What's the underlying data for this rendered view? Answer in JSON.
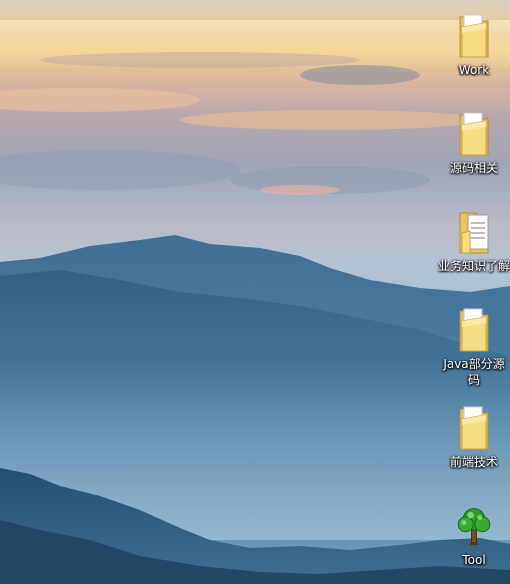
{
  "desktop": {
    "icons": [
      {
        "label": "Work",
        "icon": "folder-icon"
      },
      {
        "label": "源码相关",
        "icon": "folder-icon"
      },
      {
        "label": "业务知识了解",
        "icon": "folder-document-icon"
      },
      {
        "label": "Java部分源码",
        "icon": "folder-icon"
      },
      {
        "label": "前端技术",
        "icon": "folder-icon"
      },
      {
        "label": "Tool",
        "icon": "tree-app-icon"
      }
    ]
  }
}
